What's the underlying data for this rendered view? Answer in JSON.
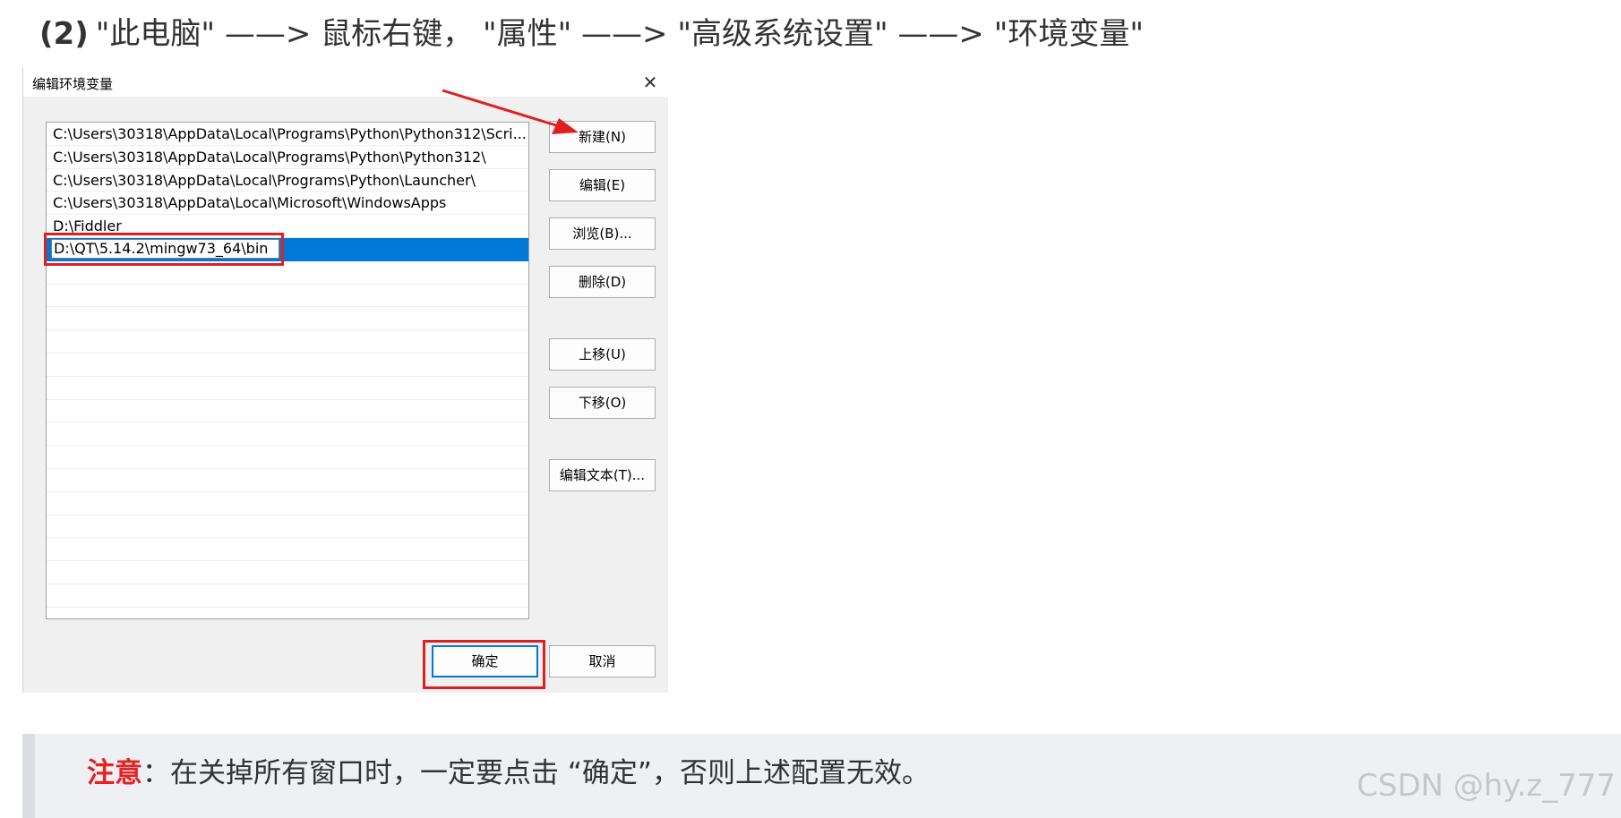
{
  "heading": {
    "step_number": "(2)",
    "text": "\"此电脑\" ——> 鼠标右键， \"属性\" ——> \"高级系统设置\" ——> \"环境变量\""
  },
  "dialog": {
    "title": "编辑环境变量",
    "close_glyph": "✕",
    "list_items": [
      "C:\\Users\\30318\\AppData\\Local\\Programs\\Python\\Python312\\Scri...",
      "C:\\Users\\30318\\AppData\\Local\\Programs\\Python\\Python312\\",
      "C:\\Users\\30318\\AppData\\Local\\Programs\\Python\\Launcher\\",
      "C:\\Users\\30318\\AppData\\Local\\Microsoft\\WindowsApps",
      "D:\\Fiddler"
    ],
    "editing_value": "D:\\QT\\5.14.2\\mingw73_64\\bin",
    "buttons": {
      "new": "新建(N)",
      "edit": "编辑(E)",
      "browse": "浏览(B)...",
      "delete": "删除(D)",
      "move_up": "上移(U)",
      "move_down": "下移(O)",
      "edit_text": "编辑文本(T)...",
      "ok": "确定",
      "cancel": "取消"
    },
    "colors": {
      "selection": "#0078d7",
      "annotation": "#e02020"
    }
  },
  "note": {
    "label": "注意",
    "separator": "：",
    "text": "在关掉所有窗口时，一定要点击 “确定”，否则上述配置无效。"
  },
  "watermark": "CSDN @hy.z_777"
}
